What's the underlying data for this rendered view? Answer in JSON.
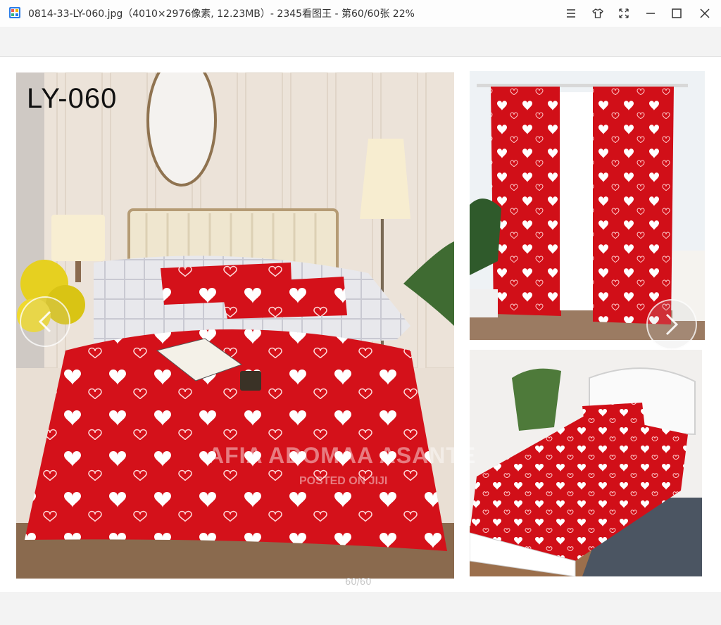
{
  "window": {
    "title": "0814-33-LY-060.jpg（4010×2976像素, 12.23MB）- 2345看图王 - 第60/60张 22%",
    "icons": [
      "app-icon",
      "menu-icon",
      "skin-icon",
      "fullscreen-icon",
      "minimize-icon",
      "maximize-icon",
      "close-icon"
    ]
  },
  "image": {
    "product_code": "LY-060",
    "watermark": "AFIA ADOMAA ASANTE",
    "watermark_sub": "POSTED ON JIJI",
    "colors": {
      "bedding_red": "#d4111a",
      "headboard": "#efe6cf",
      "wall": "#efe6dc",
      "floor": "#8a6a4e"
    }
  },
  "viewer": {
    "page_counter": "60/60",
    "nav_icons": [
      "chevron-left-icon",
      "chevron-right-icon"
    ]
  }
}
